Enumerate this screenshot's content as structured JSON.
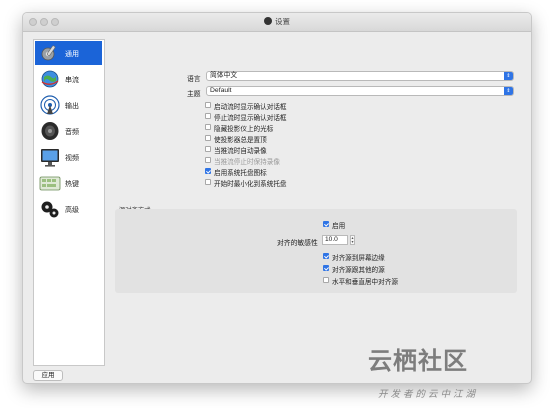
{
  "window": {
    "title": "设置"
  },
  "sidebar": {
    "items": [
      {
        "label": "通用",
        "icon": "gear-wrench-icon",
        "selected": true
      },
      {
        "label": "串流",
        "icon": "globe-icon",
        "selected": false
      },
      {
        "label": "输出",
        "icon": "broadcast-icon",
        "selected": false
      },
      {
        "label": "音频",
        "icon": "speaker-icon",
        "selected": false
      },
      {
        "label": "视频",
        "icon": "monitor-icon",
        "selected": false
      },
      {
        "label": "热键",
        "icon": "keyboard-icon",
        "selected": false
      },
      {
        "label": "高级",
        "icon": "gears-icon",
        "selected": false
      }
    ]
  },
  "general": {
    "language_label": "语言",
    "language_value": "简体中文",
    "theme_label": "主题",
    "theme_value": "Default",
    "checkboxes": [
      {
        "label": "启动流时显示确认对话框",
        "checked": false,
        "disabled": false
      },
      {
        "label": "停止流时显示确认对话框",
        "checked": false,
        "disabled": false
      },
      {
        "label": "隐藏投影仪上的光标",
        "checked": false,
        "disabled": false
      },
      {
        "label": "使投影器总是置顶",
        "checked": false,
        "disabled": false
      },
      {
        "label": "当推流时自动录像",
        "checked": false,
        "disabled": false
      },
      {
        "label": "当推流停止时保持录像",
        "checked": false,
        "disabled": true
      },
      {
        "label": "启用系统托盘图标",
        "checked": true,
        "disabled": false
      },
      {
        "label": "开始时最小化到系统托盘",
        "checked": false,
        "disabled": false
      }
    ]
  },
  "snapping": {
    "title": "源对齐方式",
    "enable_label": "启用",
    "enable_checked": true,
    "sensitivity_label": "对齐的敏感性",
    "sensitivity_value": "10.0",
    "options": [
      {
        "label": "对齐源到屏幕边缘",
        "checked": true
      },
      {
        "label": "对齐源跟其他的源",
        "checked": true
      },
      {
        "label": "水平和垂直居中对齐源",
        "checked": false
      }
    ]
  },
  "footer": {
    "apply_label": "应用"
  },
  "watermark": {
    "main": "云栖社区",
    "sub": "开发者的云中江湖"
  },
  "colors": {
    "accent": "#2f74e5",
    "selected": "#1b64d8"
  }
}
